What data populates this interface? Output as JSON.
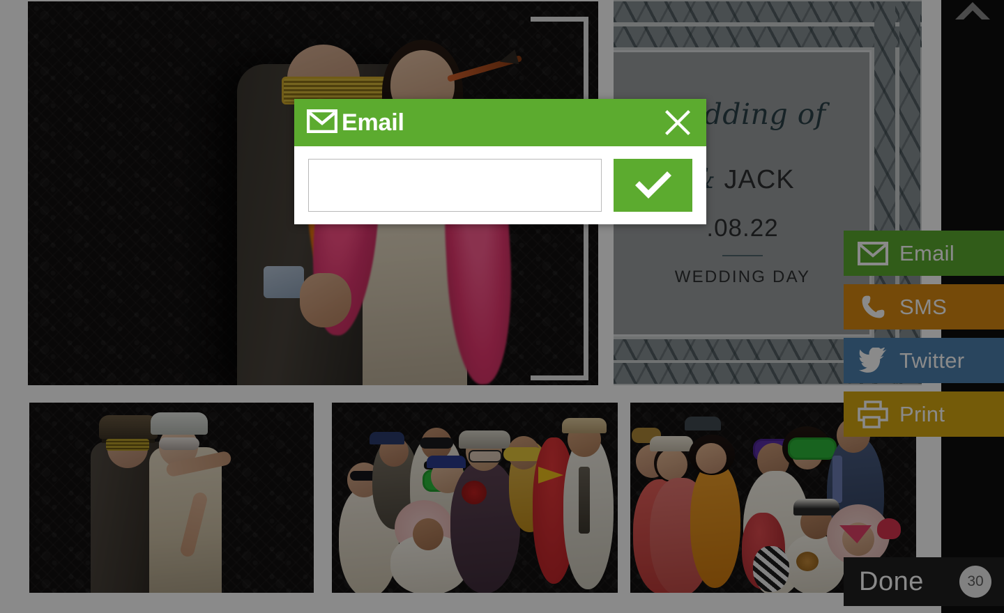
{
  "app": {
    "name": "photo-booth-gallery"
  },
  "modal": {
    "title": "Email",
    "icon": "envelope-icon",
    "close_icon": "close-icon",
    "input_value": "",
    "input_placeholder": "",
    "submit_icon": "checkmark-icon",
    "accent_color": "#5cab2f"
  },
  "share": {
    "buttons": [
      {
        "label": "Email",
        "icon": "envelope-icon",
        "color": "#5cab2f"
      },
      {
        "label": "SMS",
        "icon": "phone-icon",
        "color": "#d98a12"
      },
      {
        "label": "Twitter",
        "icon": "twitter-bird-icon",
        "color": "#4d80ae"
      },
      {
        "label": "Print",
        "icon": "printer-icon",
        "color": "#d7a912"
      }
    ]
  },
  "done": {
    "label": "Done",
    "countdown": "30"
  },
  "rail": {
    "collapse_icon": "chevron-up-icon"
  },
  "template": {
    "heading": "Wedding of",
    "names_first": "",
    "names_amp": "&",
    "names_second": "JACK",
    "date": ".08.22",
    "caption": "WEDDING DAY"
  },
  "gallery": {
    "photos": [
      {
        "name": "photo-main-couple-boas"
      },
      {
        "name": "photo-print-template"
      },
      {
        "name": "photo-couple-hats"
      },
      {
        "name": "photo-group-props"
      },
      {
        "name": "photo-group-costumes"
      }
    ]
  }
}
